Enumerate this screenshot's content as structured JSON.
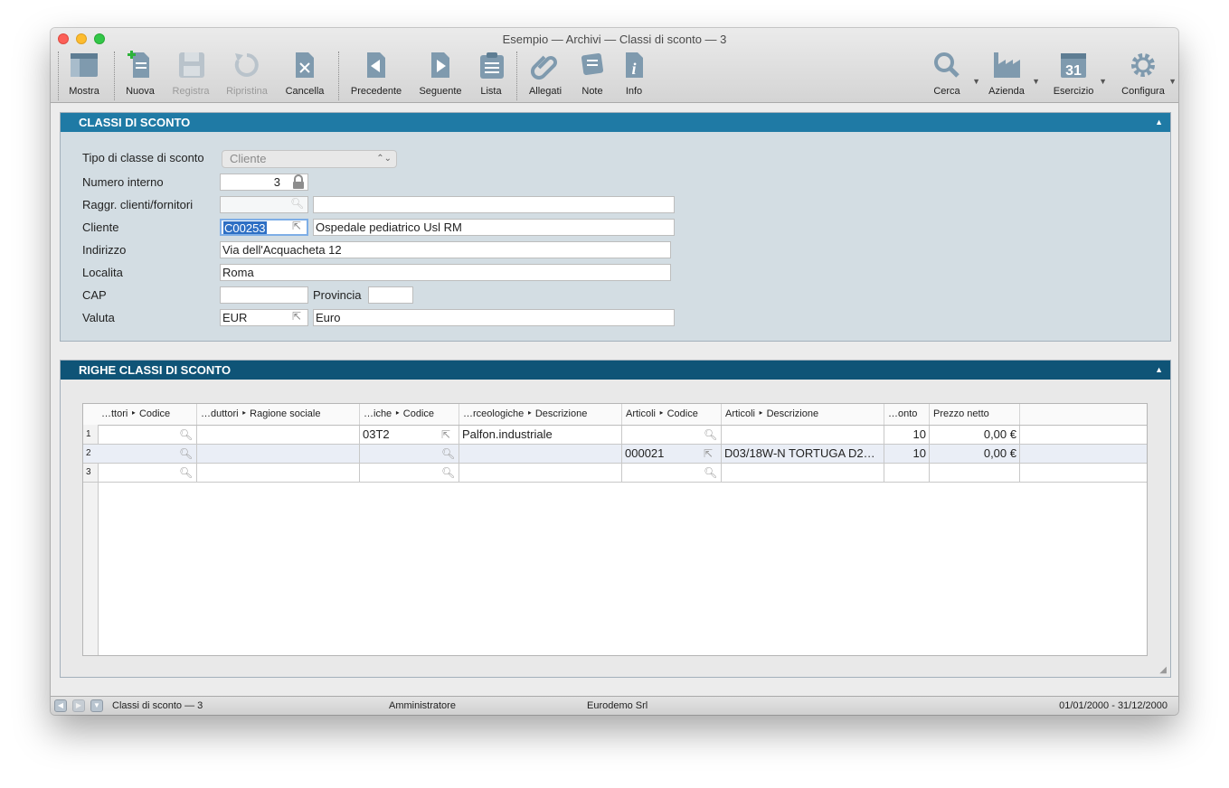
{
  "window": {
    "title": "Esempio — Archivi — Classi di sconto — 3"
  },
  "toolbar": {
    "mostra": "Mostra",
    "nuova": "Nuova",
    "registra": "Registra",
    "ripristina": "Ripristina",
    "cancella": "Cancella",
    "precedente": "Precedente",
    "seguente": "Seguente",
    "lista": "Lista",
    "allegati": "Allegati",
    "note": "Note",
    "info": "Info",
    "cerca": "Cerca",
    "azienda": "Azienda",
    "esercizio": "Esercizio",
    "configura": "Configura",
    "calendar_day": "31"
  },
  "panel1": {
    "title": "CLASSI DI SCONTO",
    "labels": {
      "tipo": "Tipo di classe di sconto",
      "numero": "Numero interno",
      "raggr": "Raggr. clienti/fornitori",
      "cliente": "Cliente",
      "indirizzo": "Indirizzo",
      "localita": "Localita",
      "cap": "CAP",
      "provincia": "Provincia",
      "valuta": "Valuta"
    },
    "values": {
      "tipo": "Cliente",
      "numero": "3",
      "raggr_code": "",
      "raggr_desc": "",
      "cliente_code": "C00253",
      "cliente_desc": "Ospedale pediatrico Usl RM",
      "indirizzo": "Via dell'Acquacheta 12",
      "localita": "Roma",
      "cap": "",
      "provincia": "",
      "valuta_code": "EUR",
      "valuta_desc": "Euro"
    }
  },
  "panel2": {
    "title": "RIGHE CLASSI DI SCONTO",
    "columns": [
      "…ttori ‣ Codice",
      "…duttori ‣ Ragione sociale",
      "…iche ‣ Codice",
      "…rceologiche ‣ Descrizione",
      "Articoli ‣ Codice",
      "Articoli ‣ Descrizione",
      "…onto",
      "Prezzo netto"
    ],
    "rows": [
      {
        "n": "1",
        "cells": [
          "",
          "",
          "03T2",
          "Palfon.industriale",
          "",
          "",
          "10",
          "0,00 €"
        ]
      },
      {
        "n": "2",
        "cells": [
          "",
          "",
          "",
          "",
          "000021",
          "D03/18W-N TORTUGA D2…",
          "10",
          "0,00 €"
        ]
      },
      {
        "n": "3",
        "cells": [
          "",
          "",
          "",
          "",
          "",
          "",
          "",
          ""
        ]
      }
    ]
  },
  "statusbar": {
    "record": "Classi di sconto — 3",
    "user": "Amministratore",
    "company": "Eurodemo Srl",
    "period": "01/01/2000 - 31/12/2000"
  },
  "colors": {
    "panel1_header": "#1f7aa5",
    "panel2_header": "#0f5477",
    "panel1_bg": "#d3dde3",
    "selection": "#2d6fc4"
  },
  "icons": [
    "mostra-icon",
    "nuova-icon",
    "registra-icon",
    "ripristina-icon",
    "cancella-icon",
    "precedente-icon",
    "seguente-icon",
    "lista-icon",
    "allegati-icon",
    "note-icon",
    "info-icon",
    "search-icon",
    "azienda-icon",
    "calendar-icon",
    "gear-icon",
    "lock-icon",
    "magnifier-icon",
    "link-arrow-icon"
  ]
}
